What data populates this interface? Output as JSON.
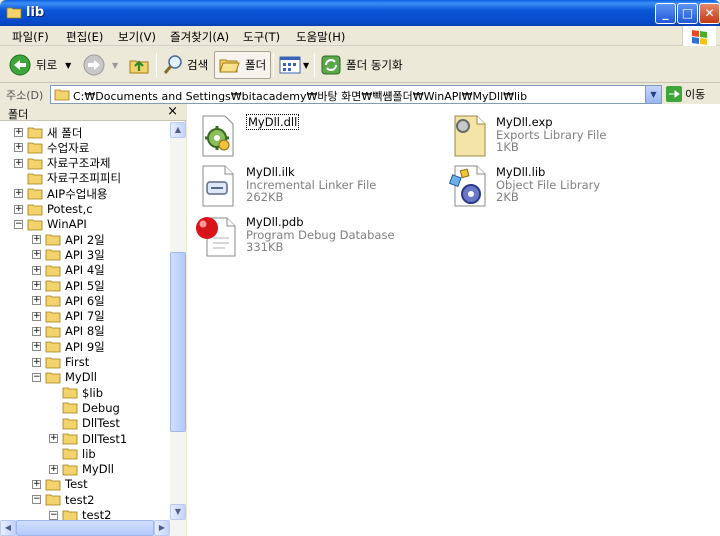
{
  "window": {
    "title": "lib",
    "min": "_",
    "max": "□",
    "close": "✕"
  },
  "menu": [
    "파일(F)",
    "편집(E)",
    "보기(V)",
    "즐겨찾기(A)",
    "도구(T)",
    "도움말(H)"
  ],
  "toolbar": {
    "back": "뒤로",
    "search": "검색",
    "folders": "폴더",
    "sync": "폴더 동기화"
  },
  "address": {
    "label": "주소(D)",
    "value": "C:₩Documents and Settings₩bitacademy₩바탕 화면₩빽썜폴더₩WinAPI₩MyDll₩lib",
    "go": "이동"
  },
  "folder_pane": {
    "title": "폴더",
    "close": "×"
  },
  "tree": [
    {
      "label": "새 폴더",
      "indent": 0,
      "toggle": "+"
    },
    {
      "label": "수업자료",
      "indent": 0,
      "toggle": "+"
    },
    {
      "label": "자료구조과제",
      "indent": 0,
      "toggle": "+"
    },
    {
      "label": "자료구조피피티",
      "indent": 0,
      "toggle": ""
    },
    {
      "label": "AIP수업내용",
      "indent": 0,
      "toggle": "+"
    },
    {
      "label": "Potest,c",
      "indent": 0,
      "toggle": "+"
    },
    {
      "label": "WinAPI",
      "indent": 0,
      "toggle": "-"
    },
    {
      "label": "API 2일",
      "indent": 1,
      "toggle": "+"
    },
    {
      "label": "API 3일",
      "indent": 1,
      "toggle": "+"
    },
    {
      "label": "API 4일",
      "indent": 1,
      "toggle": "+"
    },
    {
      "label": "API 5일",
      "indent": 1,
      "toggle": "+"
    },
    {
      "label": "API 6일",
      "indent": 1,
      "toggle": "+"
    },
    {
      "label": "API 7일",
      "indent": 1,
      "toggle": "+"
    },
    {
      "label": "API 8일",
      "indent": 1,
      "toggle": "+"
    },
    {
      "label": "API 9일",
      "indent": 1,
      "toggle": "+"
    },
    {
      "label": "First",
      "indent": 1,
      "toggle": "+"
    },
    {
      "label": "MyDll",
      "indent": 1,
      "toggle": "-"
    },
    {
      "label": "$lib",
      "indent": 2,
      "toggle": ""
    },
    {
      "label": "Debug",
      "indent": 2,
      "toggle": ""
    },
    {
      "label": "DllTest",
      "indent": 2,
      "toggle": ""
    },
    {
      "label": "DllTest1",
      "indent": 2,
      "toggle": "+"
    },
    {
      "label": "lib",
      "indent": 2,
      "toggle": ""
    },
    {
      "label": "MyDll",
      "indent": 2,
      "toggle": "+"
    },
    {
      "label": "Test",
      "indent": 1,
      "toggle": "+"
    },
    {
      "label": "test2",
      "indent": 1,
      "toggle": "-"
    },
    {
      "label": "test2",
      "indent": 2,
      "toggle": "-"
    }
  ],
  "files": [
    {
      "name": "MyDll.dll",
      "type": "",
      "size": "",
      "icon": "dll-gear-icon"
    },
    {
      "name": "MyDll.exp",
      "type": "Exports Library File",
      "size": "1KB",
      "icon": "exp-file-icon"
    },
    {
      "name": "MyDll.ilk",
      "type": "Incremental Linker File",
      "size": "262KB",
      "icon": "ilk-file-icon"
    },
    {
      "name": "MyDll.lib",
      "type": "Object File Library",
      "size": "2KB",
      "icon": "lib-file-icon"
    },
    {
      "name": "MyDll.pdb",
      "type": "Program Debug Database",
      "size": "331KB",
      "icon": "pdb-file-icon"
    }
  ]
}
